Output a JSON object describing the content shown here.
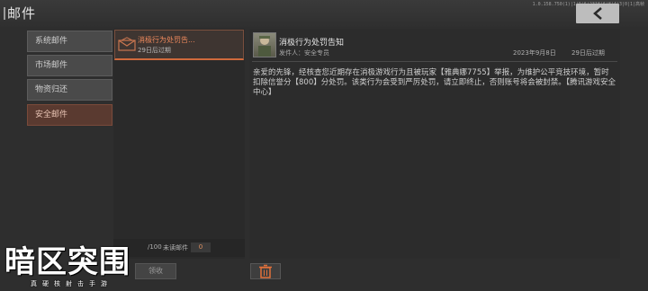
{
  "header": {
    "title": "邮件",
    "version_text": "1.0.158.750(1)|1|9|6|2318|6|8|4|3|0|1|高帧"
  },
  "tabs": [
    {
      "label": "系统邮件",
      "active": false
    },
    {
      "label": "市场邮件",
      "active": false
    },
    {
      "label": "物资归还",
      "active": false
    },
    {
      "label": "安全邮件",
      "active": true
    }
  ],
  "mail_list": {
    "items": [
      {
        "title": "消极行为处罚告...",
        "expire": "29日后过期",
        "icon": "envelope-icon"
      }
    ],
    "footer": {
      "count": "/100",
      "unread_label": "未读邮件",
      "unread_value": "0",
      "collect_label": "领收"
    }
  },
  "detail": {
    "title": "消极行为处罚告知",
    "sender": "发件人：安全专员",
    "date": "2023年9月8日",
    "expire": "29日后过期",
    "body": "亲爱的先锋，经核查您近期存在消极游戏行为且被玩家【雅典娜7755】举报，为维护公平竞技环境，暂时扣除信誉分【800】分处罚。该类行为会受到严厉处罚，请立即终止，否则账号将会被封禁。【腾讯游戏安全中心】"
  },
  "watermark": {
    "main": "暗区突围",
    "sub": "真硬核射击手游"
  },
  "colors": {
    "accent": "#d06a3c",
    "active_tab_bg": "#5a3a30"
  }
}
